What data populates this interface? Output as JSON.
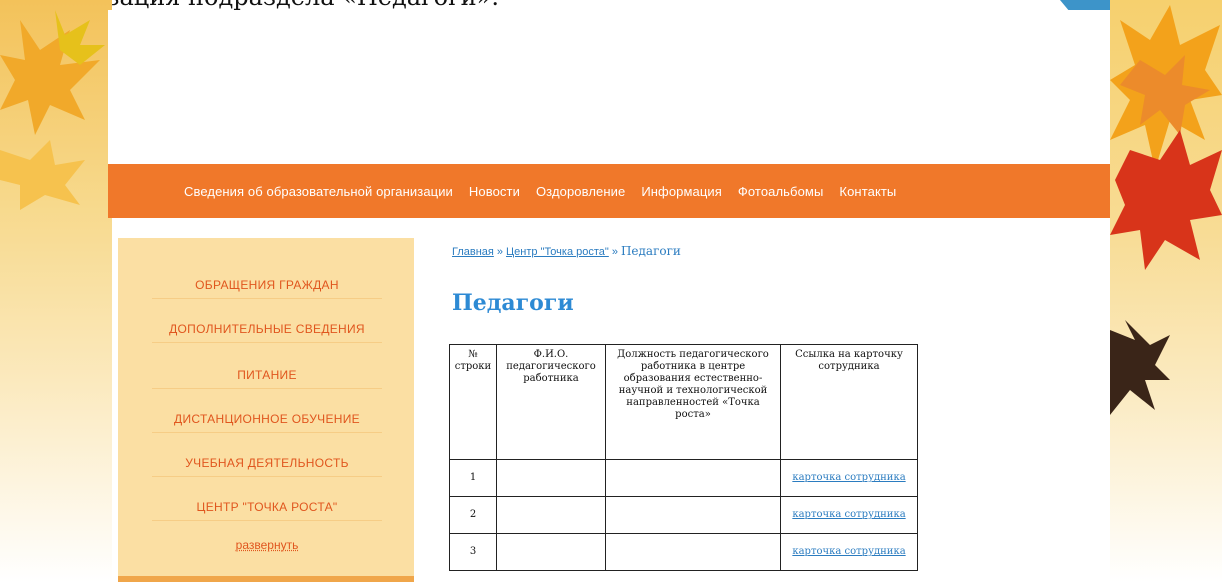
{
  "caption": "Визуализация подраздела «Педагоги».",
  "colors": {
    "nav_bg": "#f0782a",
    "sidebar_bg": "#fbdfa3",
    "sidebar_text": "#e0561e",
    "title": "#2d8ad4",
    "link": "#2b7cc0"
  },
  "nav": {
    "items": [
      {
        "label": "Сведения об образовательной организации"
      },
      {
        "label": "Новости"
      },
      {
        "label": "Оздоровление"
      },
      {
        "label": "Информация"
      },
      {
        "label": "Фотоальбомы"
      },
      {
        "label": "Контакты"
      }
    ]
  },
  "sidebar": {
    "items": [
      {
        "label": "ОБРАЩЕНИЯ ГРАЖДАН"
      },
      {
        "label": "ДОПОЛНИТЕЛЬНЫЕ СВЕДЕНИЯ"
      },
      {
        "label": "ПИТАНИЕ"
      },
      {
        "label": "ДИСТАНЦИОННОЕ ОБУЧЕНИЕ"
      },
      {
        "label": "УЧЕБНАЯ ДЕЯТЕЛЬНОСТЬ"
      },
      {
        "label": "ЦЕНТР \"ТОЧКА РОСТА\""
      }
    ],
    "expand_label": "развернуть"
  },
  "breadcrumb": {
    "home": "Главная",
    "parent": "Центр \"Точка роста\"",
    "separator": "»",
    "current": "Педагоги"
  },
  "page_title": "Педагоги",
  "table": {
    "headers": [
      "№ строки",
      "Ф.И.О. педагогического работника",
      "Должность педагогического работника в центре образования естественно-научной и технологической направленностей «Точка роста»",
      "Ссылка на карточку сотрудника"
    ],
    "rows": [
      {
        "num": "1",
        "name": "",
        "position": "",
        "link": "карточка сотрудника"
      },
      {
        "num": "2",
        "name": "",
        "position": "",
        "link": "карточка сотрудника"
      },
      {
        "num": "3",
        "name": "",
        "position": "",
        "link": "карточка сотрудника"
      }
    ]
  },
  "icons": {
    "corner": "help-corner-icon",
    "leaves": "maple-leaf-icon"
  }
}
